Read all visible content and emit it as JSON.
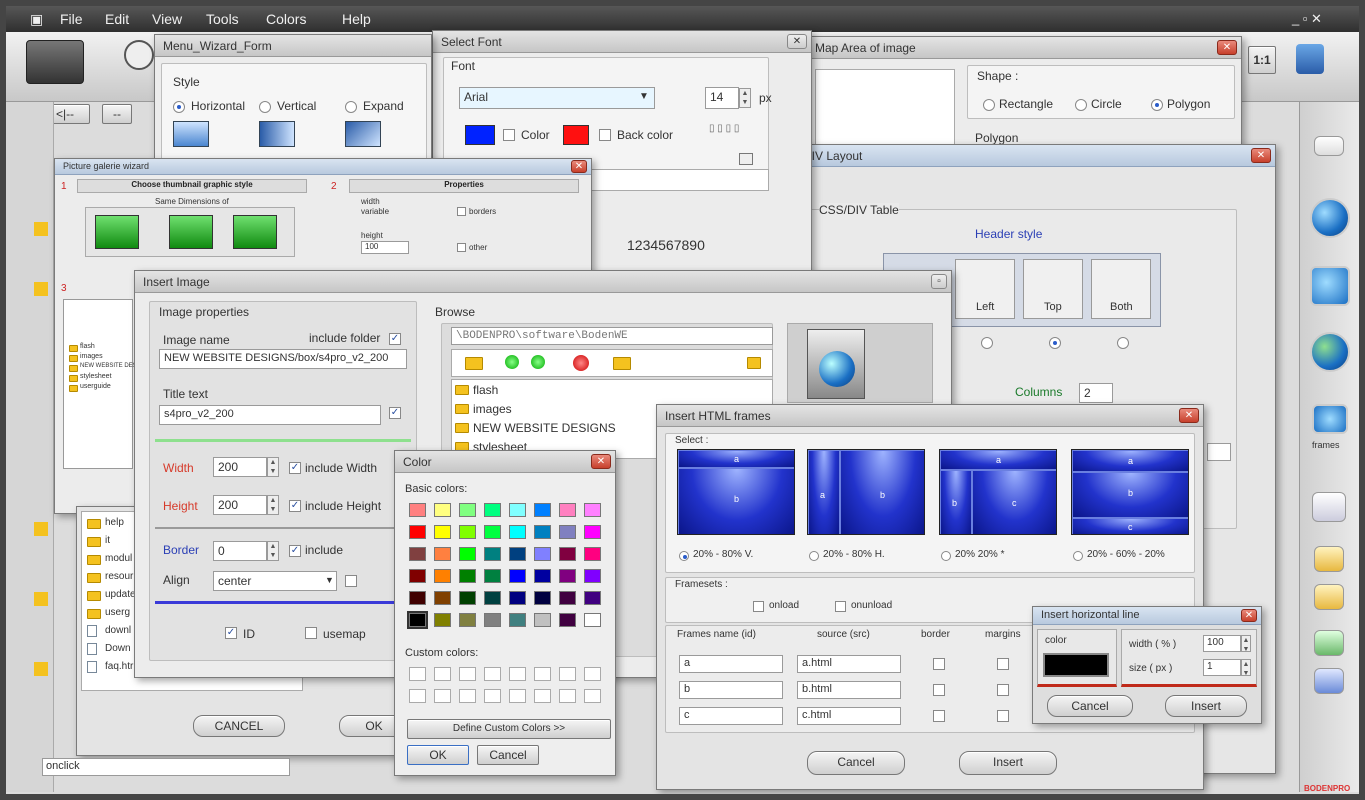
{
  "menubar": {
    "items": [
      "File",
      "Edit",
      "View",
      "Tools",
      "Colors",
      "Help"
    ],
    "controls": "_ ▫ ✕"
  },
  "menu_wizard": {
    "title": "Menu_Wizard_Form",
    "style_label": "Style",
    "options": [
      "Horizontal",
      "Vertical",
      "Expand"
    ],
    "selected": "Horizontal"
  },
  "select_font": {
    "title": "Select Font",
    "font_label": "Font",
    "font_value": "Arial",
    "size_value": "14",
    "size_unit": "px",
    "color_label": "Color",
    "back_color_label": "Back color",
    "sample_text": "1234567890",
    "color_swatch": "#0022ff",
    "back_swatch": "#ff1010"
  },
  "map_area": {
    "title": "Map Area of image",
    "shape_label": "Shape :",
    "shapes": [
      "Rectangle",
      "Circle",
      "Polygon"
    ],
    "selected": "Polygon",
    "polygon_label": "Polygon"
  },
  "css_div": {
    "title": "CSS/DIV Layout",
    "table_label": "CSS/DIV Table",
    "header_style_label": "Header style",
    "options": [
      "Left",
      "Top",
      "Both"
    ],
    "columns_label": "Columns",
    "columns_value": "2"
  },
  "picture_gallery": {
    "title": "Picture galerie wizard",
    "step1": "1",
    "step1_label": "Choose thumbnail graphic style",
    "step1_sub": "Same Dimensions of",
    "step2": "2",
    "step2_label": "Properties",
    "width_label": "width",
    "variable_label": "variable",
    "height_label": "height",
    "borders_label": "borders",
    "other_label": "other",
    "height_value": "100",
    "step3": "3",
    "tree_items": [
      "flash",
      "images",
      "NEW WEBSITE DESIGNS",
      "stylesheet",
      "userguide"
    ]
  },
  "insert_image": {
    "title": "Insert Image",
    "properties_label": "Image properties",
    "image_name_label": "Image name",
    "include_folder_label": "include folder",
    "image_name_value": "NEW WEBSITE DESIGNS/box/s4pro_v2_200",
    "title_text_label": "Title text",
    "title_text_value": "s4pro_v2_200",
    "width_label": "Width",
    "width_value": "200",
    "include_width_label": "include Width",
    "height_label": "Height",
    "height_value": "200",
    "include_height_label": "include Height",
    "border_label": "Border",
    "border_value": "0",
    "include_label": "include",
    "align_label": "Align",
    "align_value": "center",
    "id_label": "ID",
    "usemap_label": "usemap",
    "browse_label": "Browse",
    "path_value": "\\BODENPRO\\software\\BodenWE",
    "folders": [
      "flash",
      "images",
      "NEW WEBSITE DESIGNS",
      "stylesheet"
    ]
  },
  "file_list": {
    "items": [
      "help",
      "it",
      "modul",
      "resour",
      "update",
      "userg",
      "downl",
      "Down",
      "faq.htr"
    ],
    "cancel_label": "CANCEL",
    "ok_label": "OK",
    "onclick_value": "onclick"
  },
  "color_dialog": {
    "title": "Color",
    "basic_label": "Basic colors:",
    "custom_label": "Custom colors:",
    "define_label": "Define Custom Colors >>",
    "ok_label": "OK",
    "cancel_label": "Cancel",
    "swatches": [
      "#ff8080",
      "#ffff80",
      "#80ff80",
      "#00ff80",
      "#80ffff",
      "#0080ff",
      "#ff80c0",
      "#ff80ff",
      "#ff0000",
      "#ffff00",
      "#80ff00",
      "#00ff40",
      "#00ffff",
      "#0080c0",
      "#8080c0",
      "#ff00ff",
      "#804040",
      "#ff8040",
      "#00ff00",
      "#008080",
      "#004080",
      "#8080ff",
      "#800040",
      "#ff0080",
      "#800000",
      "#ff8000",
      "#008000",
      "#008040",
      "#0000ff",
      "#0000a0",
      "#800080",
      "#8000ff",
      "#400000",
      "#804000",
      "#004000",
      "#004040",
      "#000080",
      "#000040",
      "#400040",
      "#400080",
      "#000000",
      "#808000",
      "#808040",
      "#808080",
      "#408080",
      "#c0c0c0",
      "#400040",
      "#ffffff"
    ]
  },
  "html_frames": {
    "title": "Insert HTML frames",
    "select_label": "Select :",
    "layouts": [
      "20% - 80% V.",
      "20% - 80% H.",
      "20% 20% *",
      "20% - 60% - 20%"
    ],
    "selected_layout": "20% - 80% V.",
    "frame_letters": {
      "a": "a",
      "b": "b",
      "c": "c"
    },
    "framesets_label": "Framesets :",
    "onload_label": "onload",
    "onunload_label": "onunload",
    "col_name": "Frames name (id)",
    "col_source": "source (src)",
    "col_border": "border",
    "col_margins": "margins",
    "rows": [
      {
        "name": "a",
        "source": "a.html"
      },
      {
        "name": "b",
        "source": "b.html"
      },
      {
        "name": "c",
        "source": "c.html"
      }
    ],
    "cancel_label": "Cancel",
    "insert_label": "Insert"
  },
  "hline": {
    "title": "Insert horizontal line",
    "color_label": "color",
    "width_label": "width ( % )",
    "width_value": "100",
    "size_label": "size ( px )",
    "size_value": "1",
    "cancel_label": "Cancel",
    "insert_label": "Insert"
  },
  "toolbar": {
    "zoom_label": "1:1",
    "nav1": "<|-- ",
    "nav2": "--"
  },
  "right_toolbar": {
    "frames_label": "frames"
  },
  "watermark": "BODENPRO"
}
